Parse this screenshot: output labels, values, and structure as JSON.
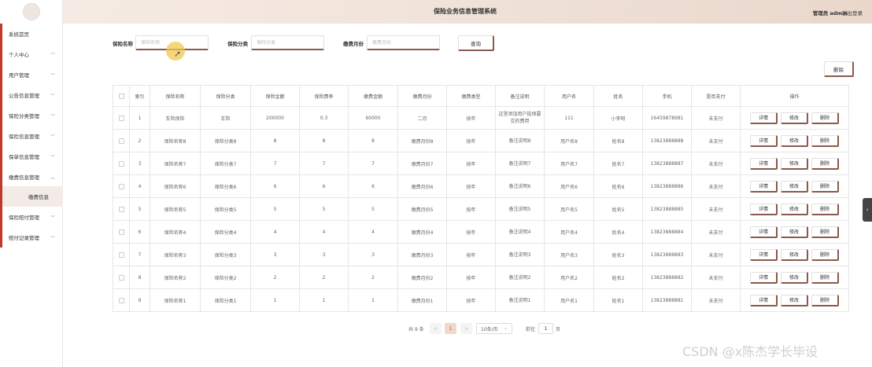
{
  "header": {
    "title": "保险业务信息管理系统",
    "role": "管理员",
    "username": "admin",
    "logout": "退出登录"
  },
  "sidebar": {
    "items": [
      {
        "label": "系统首页",
        "expandable": false
      },
      {
        "label": "个人中心",
        "expandable": true
      },
      {
        "label": "用户管理",
        "expandable": true
      },
      {
        "label": "公告信息管理",
        "expandable": true
      },
      {
        "label": "保险分类管理",
        "expandable": true
      },
      {
        "label": "保险信息管理",
        "expandable": true
      },
      {
        "label": "保单信息管理",
        "expandable": true
      },
      {
        "label": "缴费信息管理",
        "expandable": true,
        "expanded": true
      },
      {
        "label": "缴费信息",
        "sub": true,
        "active": true
      },
      {
        "label": "保险赔付管理",
        "expandable": true
      },
      {
        "label": "赔付记录管理",
        "expandable": true
      }
    ]
  },
  "search": {
    "fields": [
      {
        "label": "保险名称",
        "placeholder": "保险名称",
        "value": ""
      },
      {
        "label": "保险分类",
        "placeholder": "保险分类",
        "value": ""
      },
      {
        "label": "缴费月份",
        "placeholder": "缴费月份",
        "value": ""
      }
    ],
    "query_label": "查询"
  },
  "toolbar": {
    "delete_label": "删除"
  },
  "table": {
    "headers": [
      "索引",
      "保险名称",
      "保险分类",
      "保险金额",
      "保险费率",
      "缴费金额",
      "缴费月份",
      "缴费类型",
      "备注说明",
      "用户名",
      "姓名",
      "手机",
      "是否支付",
      "操作"
    ],
    "actions": [
      "详情",
      "修改",
      "删除"
    ],
    "rows": [
      [
        "1",
        "车险保险",
        "车险",
        "200000",
        "0.3",
        "60000",
        "二月",
        "按年",
        "这里添加用户投保要交的费用",
        "111",
        "小李呀",
        "16459878981",
        "未支付"
      ],
      [
        "2",
        "保险名称8",
        "保险分类8",
        "8",
        "8",
        "8",
        "缴费月份8",
        "按年",
        "备注说明8",
        "用户名8",
        "姓名8",
        "13823888888",
        "未支付"
      ],
      [
        "3",
        "保险名称7",
        "保险分类7",
        "7",
        "7",
        "7",
        "缴费月份7",
        "按年",
        "备注说明7",
        "用户名7",
        "姓名7",
        "13823888887",
        "未支付"
      ],
      [
        "4",
        "保险名称6",
        "保险分类6",
        "6",
        "6",
        "6",
        "缴费月份6",
        "按年",
        "备注说明6",
        "用户名6",
        "姓名6",
        "13823888886",
        "未支付"
      ],
      [
        "5",
        "保险名称5",
        "保险分类5",
        "5",
        "5",
        "5",
        "缴费月份5",
        "按年",
        "备注说明5",
        "用户名5",
        "姓名5",
        "13823888885",
        "未支付"
      ],
      [
        "6",
        "保险名称4",
        "保险分类4",
        "4",
        "4",
        "4",
        "缴费月份4",
        "按年",
        "备注说明4",
        "用户名4",
        "姓名4",
        "13823888884",
        "未支付"
      ],
      [
        "7",
        "保险名称3",
        "保险分类3",
        "3",
        "3",
        "3",
        "缴费月份3",
        "按年",
        "备注说明3",
        "用户名3",
        "姓名3",
        "13823888883",
        "未支付"
      ],
      [
        "8",
        "保险名称2",
        "保险分类2",
        "2",
        "2",
        "2",
        "缴费月份2",
        "按年",
        "备注说明2",
        "用户名2",
        "姓名2",
        "13823888882",
        "未支付"
      ],
      [
        "9",
        "保险名称1",
        "保险分类1",
        "1",
        "1",
        "1",
        "缴费月份1",
        "按年",
        "备注说明1",
        "用户名1",
        "姓名1",
        "13823888881",
        "未支付"
      ]
    ]
  },
  "pagination": {
    "total_text": "共 9 条",
    "prev": "<",
    "current_page": "1",
    "next": ">",
    "page_size": "10条/页",
    "goto_label": "前往",
    "goto_value": "1",
    "page_suffix": "页"
  },
  "side_tab_icon": "chevron-left-icon",
  "watermark": "CSDN @x陈杰学长毕设",
  "colors": {
    "accent": "#8a5a4a",
    "header_bg": "#f0e2d8",
    "sidebar_marker": "#c0392b",
    "active_submenu_bg": "#f3ebe6"
  }
}
